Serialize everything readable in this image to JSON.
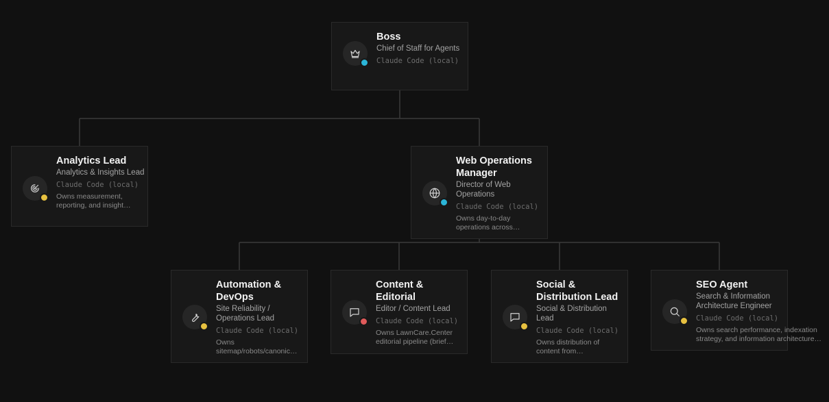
{
  "colors": {
    "background": "#111111",
    "card": "#181818",
    "card_border": "#2a2a2a",
    "connector": "#3a3a3a",
    "status_blue": "#2bb5d8",
    "status_yellow": "#e7c140",
    "status_red": "#e05a5a"
  },
  "org": {
    "boss": {
      "name": "Boss",
      "role": "Chief of Staff for Agents",
      "runtime": "Claude Code (local)",
      "icon": "crown-icon",
      "status_color": "#2bb5d8"
    },
    "analytics": {
      "name": "Analytics Lead",
      "role": "Analytics & Insights Lead",
      "runtime": "Claude Code (local)",
      "description": "Owns measurement, reporting, and insight…",
      "icon": "radar-icon",
      "status_color": "#e7c140"
    },
    "webops": {
      "name": "Web Operations Manager",
      "role": "Director of Web Operations",
      "runtime": "Claude Code (local)",
      "description": "Owns day-to-day operations across…",
      "icon": "globe-icon",
      "status_color": "#2bb5d8"
    },
    "automation": {
      "name": "Automation & DevOps",
      "role": "Site Reliability / Operations Lead",
      "runtime": "Claude Code (local)",
      "description": "Owns sitemap/robots/canonic…",
      "icon": "wrench-icon",
      "status_color": "#e7c140"
    },
    "content": {
      "name": "Content & Editorial",
      "role": "Editor / Content Lead",
      "runtime": "Claude Code (local)",
      "description": "Owns LawnCare.Center editorial pipeline (brief…",
      "icon": "message-square-icon",
      "status_color": "#e05a5a"
    },
    "social": {
      "name": "Social & Distribution Lead",
      "role": "Social & Distribution Lead",
      "runtime": "Claude Code (local)",
      "description": "Owns distribution of content from…",
      "icon": "message-square-icon",
      "status_color": "#e7c140"
    },
    "seo": {
      "name": "SEO Agent",
      "role": "Search & Information Architecture Engineer",
      "runtime": "Claude Code (local)",
      "description": "Owns search performance, indexation strategy, and information architecture…",
      "icon": "search-icon",
      "status_color": "#e7c140"
    }
  }
}
